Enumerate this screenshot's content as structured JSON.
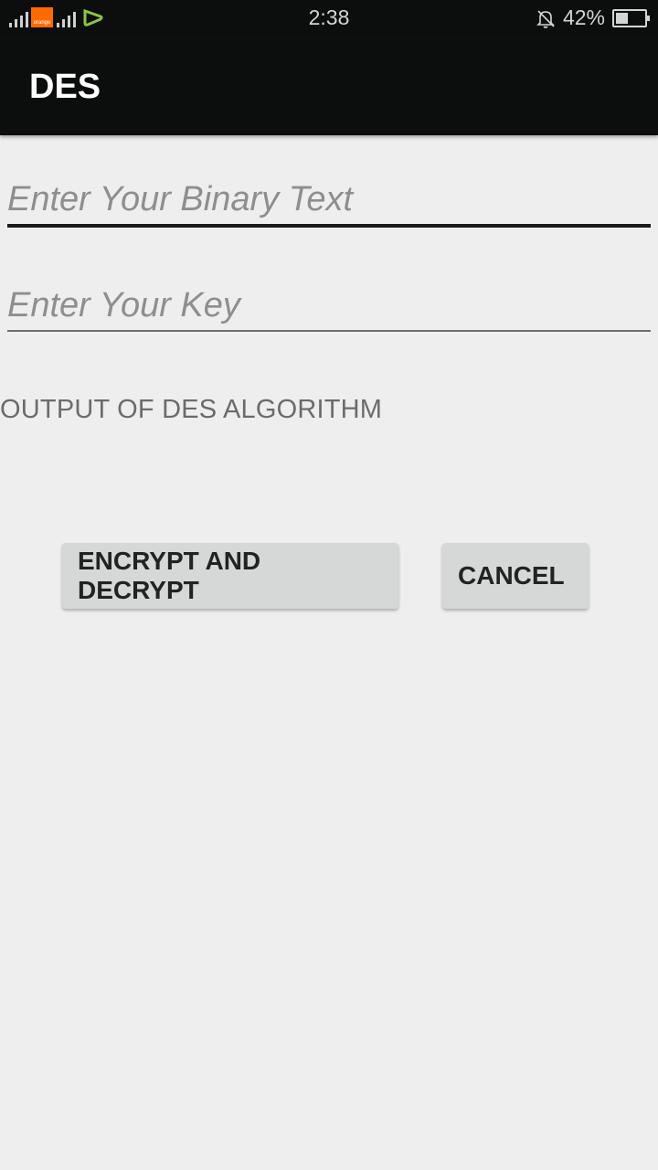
{
  "status_bar": {
    "time": "2:38",
    "battery_percent": "42%",
    "battery_level": 0.42,
    "carrier_badge": "orange",
    "icons": [
      "signal-icon",
      "orange-carrier-icon",
      "signal-icon",
      "etisalat-carrier-icon",
      "notifications-off-icon",
      "battery-icon"
    ]
  },
  "app_bar": {
    "title": "DES"
  },
  "form": {
    "binary_text": {
      "value": "",
      "placeholder": "Enter Your Binary Text"
    },
    "key": {
      "value": "",
      "placeholder": "Enter Your Key"
    }
  },
  "output": {
    "label": "OUTPUT OF DES ALGORITHM"
  },
  "buttons": {
    "encrypt_label": "ENCRYPT AND DECRYPT",
    "cancel_label": "CANCEL"
  },
  "colors": {
    "app_bar": "#0c0e0e",
    "background": "#eeeeee",
    "button": "#d6d7d7",
    "orange_brand": "#ff6a00",
    "etisalat_brand": "#8cc63f"
  }
}
